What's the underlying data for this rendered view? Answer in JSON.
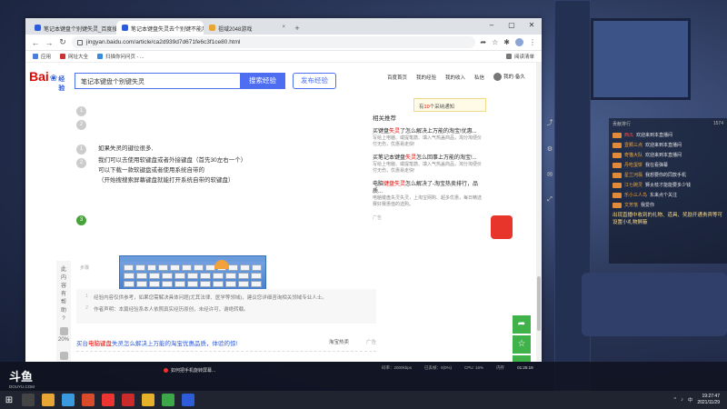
{
  "browser": {
    "tabs": [
      {
        "label": "笔记本键盘个别键失灵_百度搜索",
        "active": false
      },
      {
        "label": "笔记本键盘失灵去个别键不能用...",
        "active": true
      },
      {
        "label": "祖域2048游戏",
        "active": false
      }
    ],
    "url": "jingyan.baidu.com/article/ca2d939d7d671fe6c3f1ce80.html",
    "bookmarks": [
      "应用",
      "网址大全",
      "扫描你问问页 - ..."
    ],
    "reading_list": "阅读清单"
  },
  "site": {
    "logo_text": "Bai",
    "logo_sub": "经验",
    "search_value": "笔记本键盘个别键失灵",
    "search_button": "搜索经验",
    "publish_button": "发布经验",
    "nav": [
      "百度首页",
      "我的经验",
      "我的收入",
      "私信"
    ],
    "user": "我的·备久",
    "popup_prefix": "有",
    "popup_count": "10",
    "popup_suffix": "个采纳通知"
  },
  "article": {
    "step_numbers": [
      "1",
      "2",
      "1",
      "2",
      "3"
    ],
    "lines": [
      "如果失灵的键位很多,",
      "我们可以去使用软键盘或者外接键盘（首先30左右一个）",
      "可以下载一款软键盘或者使用系统自带的",
      "（开始搜搜索屏幕键盘就能打开系统自带的软键盘）"
    ],
    "source_label": "步骤",
    "vote_text": [
      "此",
      "内",
      "容",
      "有",
      "帮",
      "助",
      "?"
    ],
    "vote_count": "20%",
    "notes": [
      {
        "num": "1",
        "text": "经验内容仅供参考，如果您需解决具体问题(尤其法律、医学等领域)，建议您详细咨询相关领域专业人士。"
      },
      {
        "num": "2",
        "text": "作者声明：本篇经验系本人依照真实经历原创，未经许可，谢绝转载。"
      }
    ],
    "bottom_link_prefix": "买台",
    "bottom_link_em1": "电脑键盘",
    "bottom_link_mid": "失灵怎么解决上万能的淘宝优惠品质，体验的惊!",
    "bottom_link_source": "淘宝热卖",
    "bottom_link_ad": "广告"
  },
  "sidebar": {
    "title": "相关推荐",
    "items": [
      {
        "title_prefix": "买键盘",
        "title_em": "失灵",
        "title_rest": "了怎么解决上万能的淘宝!优惠...",
        "desc": "写给上电脑、或提笔筋、填入气热盖商品，淘分淘便价付无伤，优惠易走快!"
      },
      {
        "title_prefix": "买笔记本键盘",
        "title_em": "失灵",
        "title_rest": "怎么回事上万能的淘宝!...",
        "desc": "写给上电脑、或提笔筋、填入气热盖商品，淘分淘便价付无伤，优惠易走快!"
      },
      {
        "title_prefix": "电脑",
        "title_em": "键盘失灵",
        "title_rest": "怎么解决了-淘宝热卖排行，品质...",
        "desc": "电脑键盘失灵失灵，上淘宝网购、超多优惠，每日精选赛好赛惠值的选购。"
      }
    ],
    "ad_label": "广告"
  },
  "stream": {
    "panel_head": [
      "贡献排行",
      "1574"
    ],
    "chat": [
      {
        "name": "西瓜",
        "text": "欢迎来到本直播间",
        "red": true
      },
      {
        "name": "壹颗三点",
        "text": "欢迎来到本直播间",
        "red": false
      },
      {
        "name": "奇猫大队",
        "text": "欢迎来到本直播间",
        "red": false
      },
      {
        "name": "丹吃蛋饼",
        "text": "我在看弹幕",
        "red": false
      },
      {
        "name": "星兰河翡",
        "text": "我想要你的同款手机",
        "red": false
      },
      {
        "name": "江七碗灵",
        "text": "狮太枝才能能要多少钱",
        "red": false
      },
      {
        "name": "乐小三人鸟",
        "text": "东来点个关注",
        "red": false
      },
      {
        "name": "文芳落",
        "text": "我爱你",
        "red": false
      }
    ],
    "system_msg": "出现直播中收到的礼物、道具、奖励开通贵宾等可设置小礼物屏蔽",
    "douyu_logo": "斗鱼",
    "douyu_sub": "DOUYU.COM",
    "notif_text": "如何把手机旋转屏幕...",
    "status_items": [
      "码率：2000kbps",
      "已丢帧：0(0%)",
      "CPU: 16%",
      "内存",
      "01:25:19"
    ],
    "timer": "01:25:19"
  },
  "taskbar": {
    "time": "19:27:47",
    "date": "2021/11/29",
    "tray_lang": "中"
  }
}
